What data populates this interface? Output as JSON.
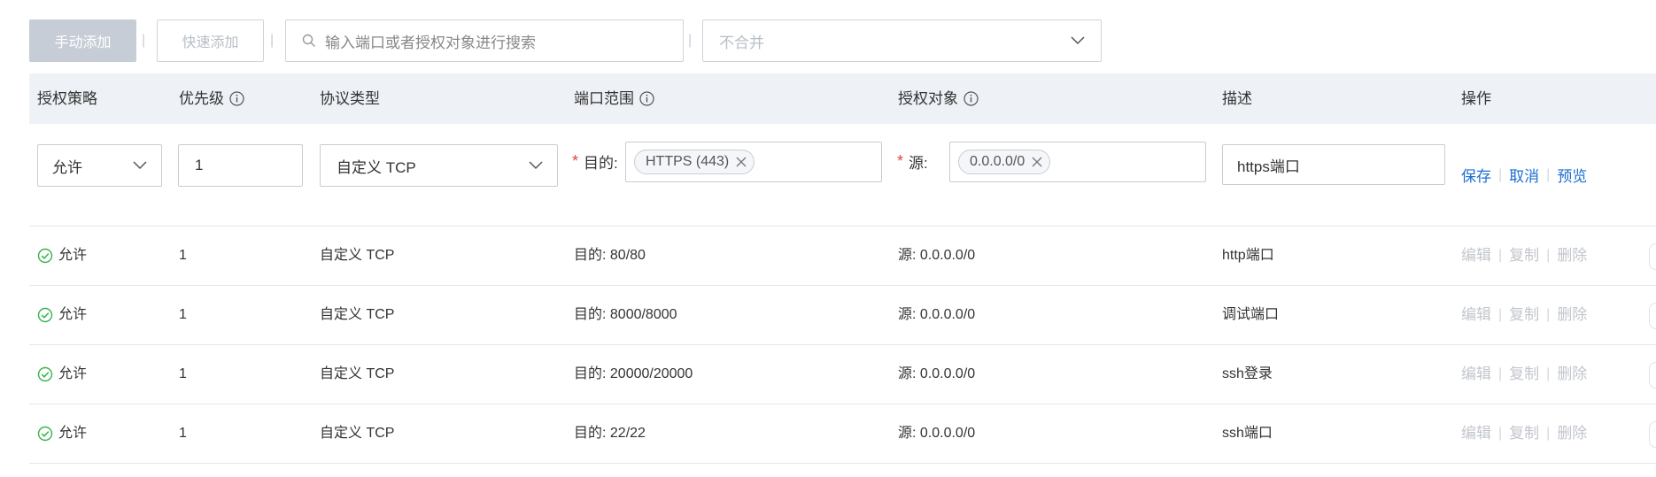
{
  "toolbar": {
    "manual_add": "手动添加",
    "quick_add": "快速添加",
    "separator": "|",
    "search_placeholder": "输入端口或者授权对象进行搜索",
    "merge_select_value": "不合并"
  },
  "headers": {
    "policy": "授权策略",
    "priority": "优先级",
    "protocol": "协议类型",
    "port_range": "端口范围",
    "auth_object": "授权对象",
    "description": "描述",
    "operation": "操作"
  },
  "edit_row": {
    "policy": "允许",
    "priority": "1",
    "protocol": "自定义 TCP",
    "required_mark": "*",
    "dest_label": "目的:",
    "dest_tag": "HTTPS (443)",
    "source_label": "源:",
    "source_tag": "0.0.0.0/0",
    "description": "https端口",
    "save": "保存",
    "cancel": "取消",
    "preview": "预览",
    "separator": "|"
  },
  "ops": {
    "edit": "编辑",
    "copy": "复制",
    "delete": "删除",
    "separator": "|"
  },
  "rows": [
    {
      "policy": "允许",
      "priority": "1",
      "protocol": "自定义 TCP",
      "port": "目的: 80/80",
      "source": "源: 0.0.0.0/0",
      "description": "http端口"
    },
    {
      "policy": "允许",
      "priority": "1",
      "protocol": "自定义 TCP",
      "port": "目的: 8000/8000",
      "source": "源: 0.0.0.0/0",
      "description": "调试端口"
    },
    {
      "policy": "允许",
      "priority": "1",
      "protocol": "自定义 TCP",
      "port": "目的: 20000/20000",
      "source": "源: 0.0.0.0/0",
      "description": "ssh登录"
    },
    {
      "policy": "允许",
      "priority": "1",
      "protocol": "自定义 TCP",
      "port": "目的: 22/22",
      "source": "源: 0.0.0.0/0",
      "description": "ssh端口"
    }
  ],
  "colors": {
    "link": "#1b6fd1",
    "success": "#35b34a",
    "required": "#e0443c",
    "header_bg": "#eef1f6"
  }
}
